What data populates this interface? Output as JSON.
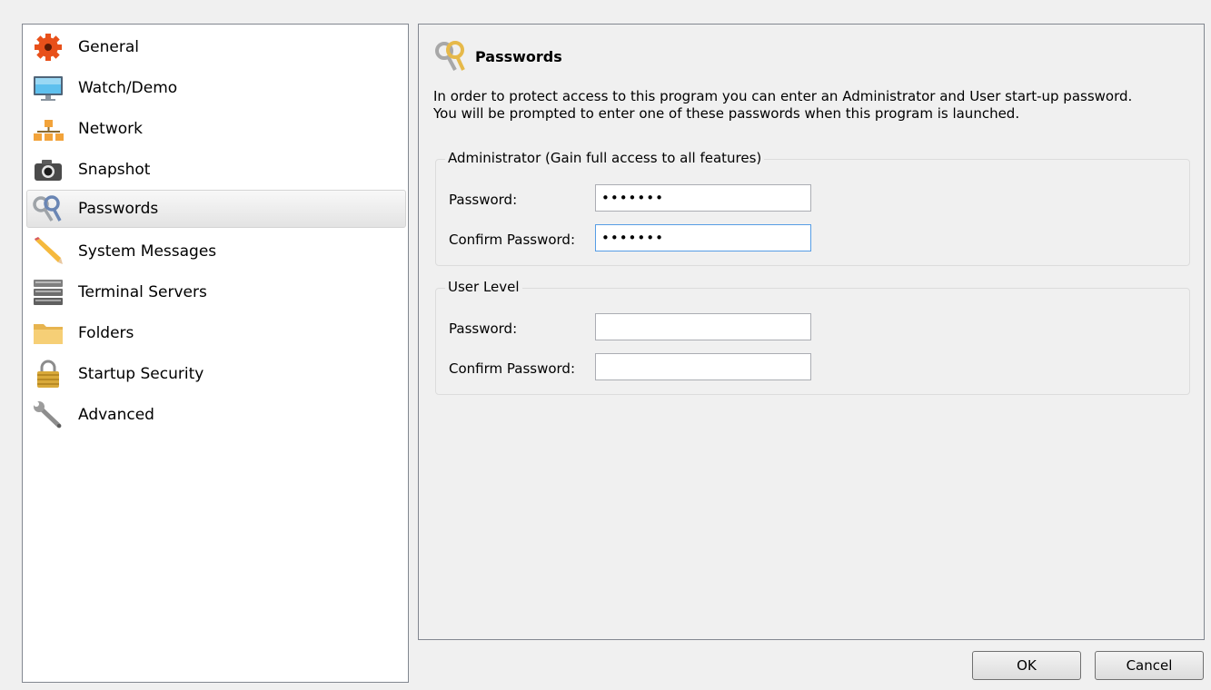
{
  "sidebar": {
    "items": [
      {
        "label": "General",
        "icon": "gear-icon"
      },
      {
        "label": "Watch/Demo",
        "icon": "monitor-icon"
      },
      {
        "label": "Network",
        "icon": "network-icon"
      },
      {
        "label": "Snapshot",
        "icon": "camera-icon"
      },
      {
        "label": "Passwords",
        "icon": "keys-icon",
        "selected": true
      },
      {
        "label": "System Messages",
        "icon": "pencil-icon"
      },
      {
        "label": "Terminal Servers",
        "icon": "server-icon"
      },
      {
        "label": "Folders",
        "icon": "folder-icon"
      },
      {
        "label": "Startup Security",
        "icon": "padlock-icon"
      },
      {
        "label": "Advanced",
        "icon": "wrench-icon"
      }
    ]
  },
  "panel": {
    "title": "Passwords",
    "description_line1": "In order to protect access to this program you can enter an Administrator and User start-up password.",
    "description_line2": "You will be prompted to enter one of these passwords when this program is launched.",
    "admin_group": {
      "legend": "Administrator (Gain full access to all features)",
      "password_label": "Password:",
      "password_value": "•••••••",
      "confirm_label": "Confirm Password:",
      "confirm_value": "•••••••"
    },
    "user_group": {
      "legend": "User Level",
      "password_label": "Password:",
      "password_value": "",
      "confirm_label": "Confirm Password:",
      "confirm_value": ""
    }
  },
  "buttons": {
    "ok": "OK",
    "cancel": "Cancel"
  }
}
